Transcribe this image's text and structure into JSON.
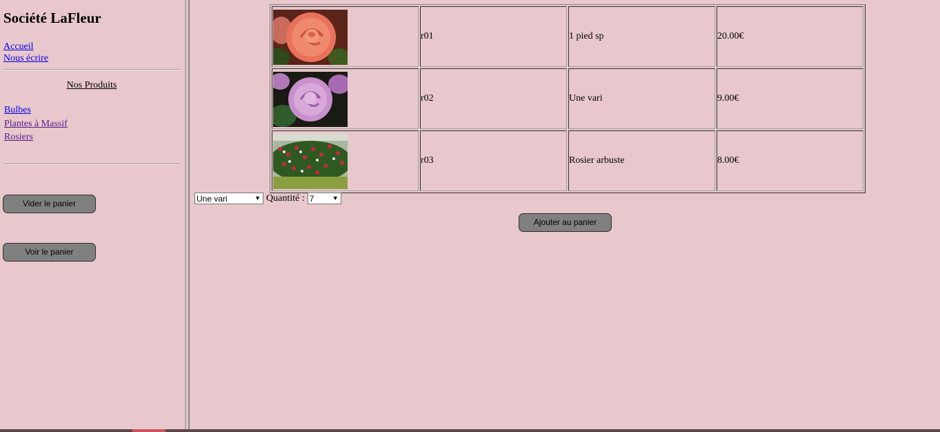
{
  "sidebar": {
    "title": "Société LaFleur",
    "nav_links": [
      {
        "label": "Accueil"
      },
      {
        "label": "Nous écrire"
      }
    ],
    "products_heading": "Nos Produits",
    "product_links": [
      {
        "label": "Bulbes"
      },
      {
        "label": "Plantes à Massif"
      },
      {
        "label": "Rosiers"
      }
    ],
    "empty_cart_label": "Vider le panier",
    "view_cart_label": "Voir le panier"
  },
  "products": [
    {
      "image_icon": "orange-rose-photo",
      "ref": "r01",
      "description": "1 pied sp",
      "price": "20.00€"
    },
    {
      "image_icon": "purple-rose-photo",
      "ref": "r02",
      "description": "Une vari",
      "price": "9.00€"
    },
    {
      "image_icon": "rose-bush-photo",
      "ref": "r03",
      "description": "Rosier arbuste",
      "price": "8.00€"
    }
  ],
  "order_form": {
    "variety_selected": "Une vari",
    "quantity_label": "Quantité :",
    "quantity_selected": "7",
    "add_to_cart_label": "Ajouter au panier"
  },
  "colors": {
    "page_background": "#e8c8cc",
    "button_background": "#808080",
    "link": "#0000ee",
    "visited_link": "#551a8b"
  }
}
